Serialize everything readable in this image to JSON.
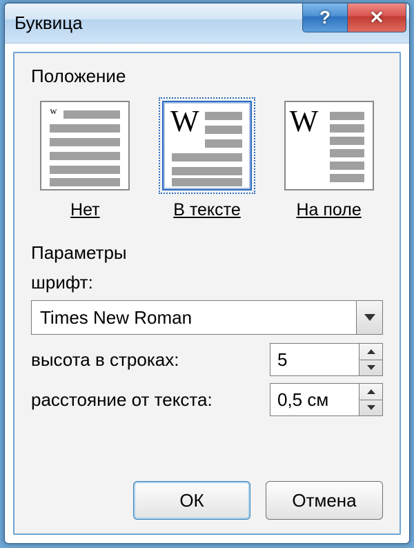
{
  "title": "Буквица",
  "position": {
    "group_label": "Положение",
    "options": {
      "none": "Нет",
      "in_text": "В тексте",
      "in_margin": "На поле"
    },
    "selected": "in_text"
  },
  "parameters": {
    "group_label": "Параметры",
    "font_label": "шрифт:",
    "font_value": "Times New Roman",
    "lines_label": "высота в строках:",
    "lines_value": "5",
    "distance_label": "расстояние от текста:",
    "distance_value": "0,5 см"
  },
  "buttons": {
    "ok": "ОК",
    "cancel": "Отмена",
    "help_glyph": "?",
    "close_glyph": "✕"
  }
}
